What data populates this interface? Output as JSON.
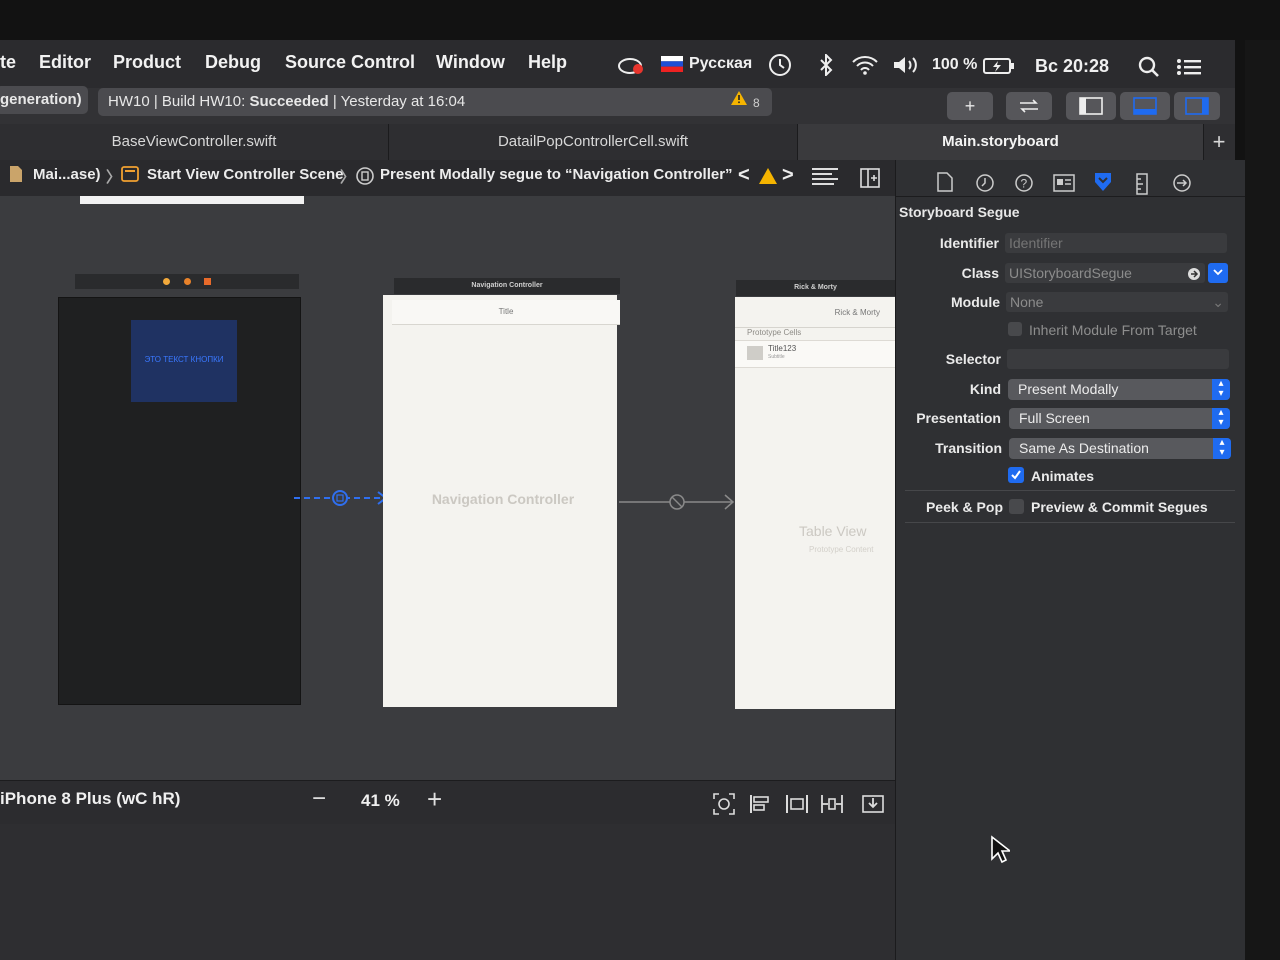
{
  "menubar": {
    "items": [
      "te",
      "Editor",
      "Product",
      "Debug",
      "Source Control",
      "Window",
      "Help"
    ],
    "status": {
      "input_source": "Русская",
      "battery": "100 %",
      "clock": "Вс 20:28"
    }
  },
  "toolbar": {
    "scheme_fragment": "generation)",
    "activity_prefix": "HW10 | Build HW10: ",
    "activity_status": "Succeeded",
    "activity_suffix": " | Yesterday at 16:04",
    "warning_count": "8"
  },
  "tabs": [
    {
      "label": "BaseViewController.swift"
    },
    {
      "label": "DatailPopControllerCell.swift"
    },
    {
      "label": "Main.storyboard"
    }
  ],
  "jumpbar": {
    "crumb1": "Mai...ase)",
    "crumb2": "Start View Controller Scene",
    "crumb3": "Present Modally segue to “Navigation Controller”"
  },
  "canvas": {
    "start_vc": {
      "button_text": "ЭТО ТЕКСТ КНОПКИ"
    },
    "nav_controller": {
      "bar_title": "Navigation Controller",
      "nav_item": "Title",
      "placeholder": "Navigation Controller"
    },
    "table_vc": {
      "bar_title": "Rick & Morty",
      "nav_item": "Rick & Morty",
      "section": "Prototype Cells",
      "cell_title": "Title123",
      "cell_subtitle": "Subtitle",
      "placeholder": "Table View",
      "placeholder_sub": "Prototype Content"
    }
  },
  "bottombar": {
    "device": "iPhone 8 Plus (wC hR)",
    "zoom": "41 %"
  },
  "inspector": {
    "section_title": "Storyboard Segue",
    "identifier_label": "Identifier",
    "identifier_placeholder": "Identifier",
    "class_label": "Class",
    "class_value": "UIStoryboardSegue",
    "module_label": "Module",
    "module_value": "None",
    "inherit_label": "Inherit Module From Target",
    "selector_label": "Selector",
    "kind_label": "Kind",
    "kind_value": "Present Modally",
    "presentation_label": "Presentation",
    "presentation_value": "Full Screen",
    "transition_label": "Transition",
    "transition_value": "Same As Destination",
    "animates_label": "Animates",
    "animates_checked": true,
    "peek_label": "Peek & Pop",
    "peek_checkbox_label": "Preview & Commit Segues",
    "peek_checked": false
  },
  "colors": {
    "accent": "#1f6bf0",
    "segue_line": "#2f6ff0",
    "warning": "#f5b400",
    "button_bg": "#1f3262",
    "button_text": "#3a78ff"
  }
}
